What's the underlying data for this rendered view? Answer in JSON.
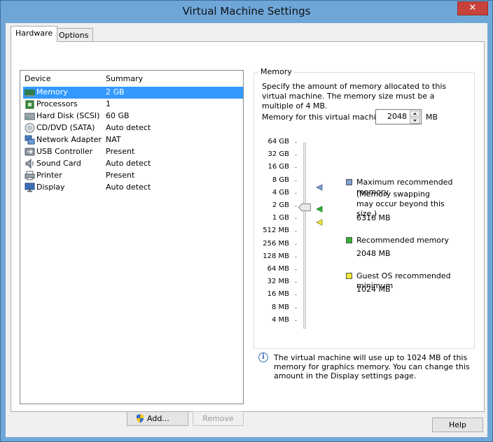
{
  "window": {
    "title": "Virtual Machine Settings",
    "close_glyph": "✕"
  },
  "tabs": [
    {
      "label": "Hardware",
      "active": true
    },
    {
      "label": "Options",
      "active": false
    }
  ],
  "device_list": {
    "columns": [
      "Device",
      "Summary"
    ],
    "rows": [
      {
        "device": "Memory",
        "summary": "2 GB",
        "icon": "memory-icon",
        "selected": true
      },
      {
        "device": "Processors",
        "summary": "1",
        "icon": "processor-icon"
      },
      {
        "device": "Hard Disk (SCSI)",
        "summary": "60 GB",
        "icon": "hard-disk-icon"
      },
      {
        "device": "CD/DVD (SATA)",
        "summary": "Auto detect",
        "icon": "cd-dvd-icon"
      },
      {
        "device": "Network Adapter",
        "summary": "NAT",
        "icon": "network-adapter-icon"
      },
      {
        "device": "USB Controller",
        "summary": "Present",
        "icon": "usb-controller-icon"
      },
      {
        "device": "Sound Card",
        "summary": "Auto detect",
        "icon": "sound-card-icon"
      },
      {
        "device": "Printer",
        "summary": "Present",
        "icon": "printer-icon"
      },
      {
        "device": "Display",
        "summary": "Auto detect",
        "icon": "display-icon"
      }
    ]
  },
  "buttons": {
    "add": "Add...",
    "remove": "Remove",
    "help": "Help"
  },
  "memory": {
    "group_title": "Memory",
    "description": "Specify the amount of memory allocated to this virtual machine. The memory size must be a multiple of 4 MB.",
    "field_label": "Memory for this virtual machine:",
    "value": "2048",
    "unit": "MB",
    "scale": [
      "64 GB",
      "32 GB",
      "16 GB",
      "8 GB",
      "4 GB",
      "2 GB",
      "1 GB",
      "512 MB",
      "256 MB",
      "128 MB",
      "64 MB",
      "32 MB",
      "16 MB",
      "8 MB",
      "4 MB"
    ],
    "legend": {
      "max": {
        "title": "Maximum recommended memory",
        "note": "(Memory swapping may occur beyond this size.)",
        "value": "6316 MB",
        "color": "#7f9fd0"
      },
      "recommended": {
        "title": "Recommended memory",
        "value": "2048 MB",
        "color": "#34b233"
      },
      "guest_min": {
        "title": "Guest OS recommended minimum",
        "value": "1024 MB",
        "color": "#f2e83a"
      }
    }
  },
  "info": {
    "text": "The virtual machine will use up to 1024 MB of this memory for graphics memory. You can change this amount in the Display settings page."
  }
}
